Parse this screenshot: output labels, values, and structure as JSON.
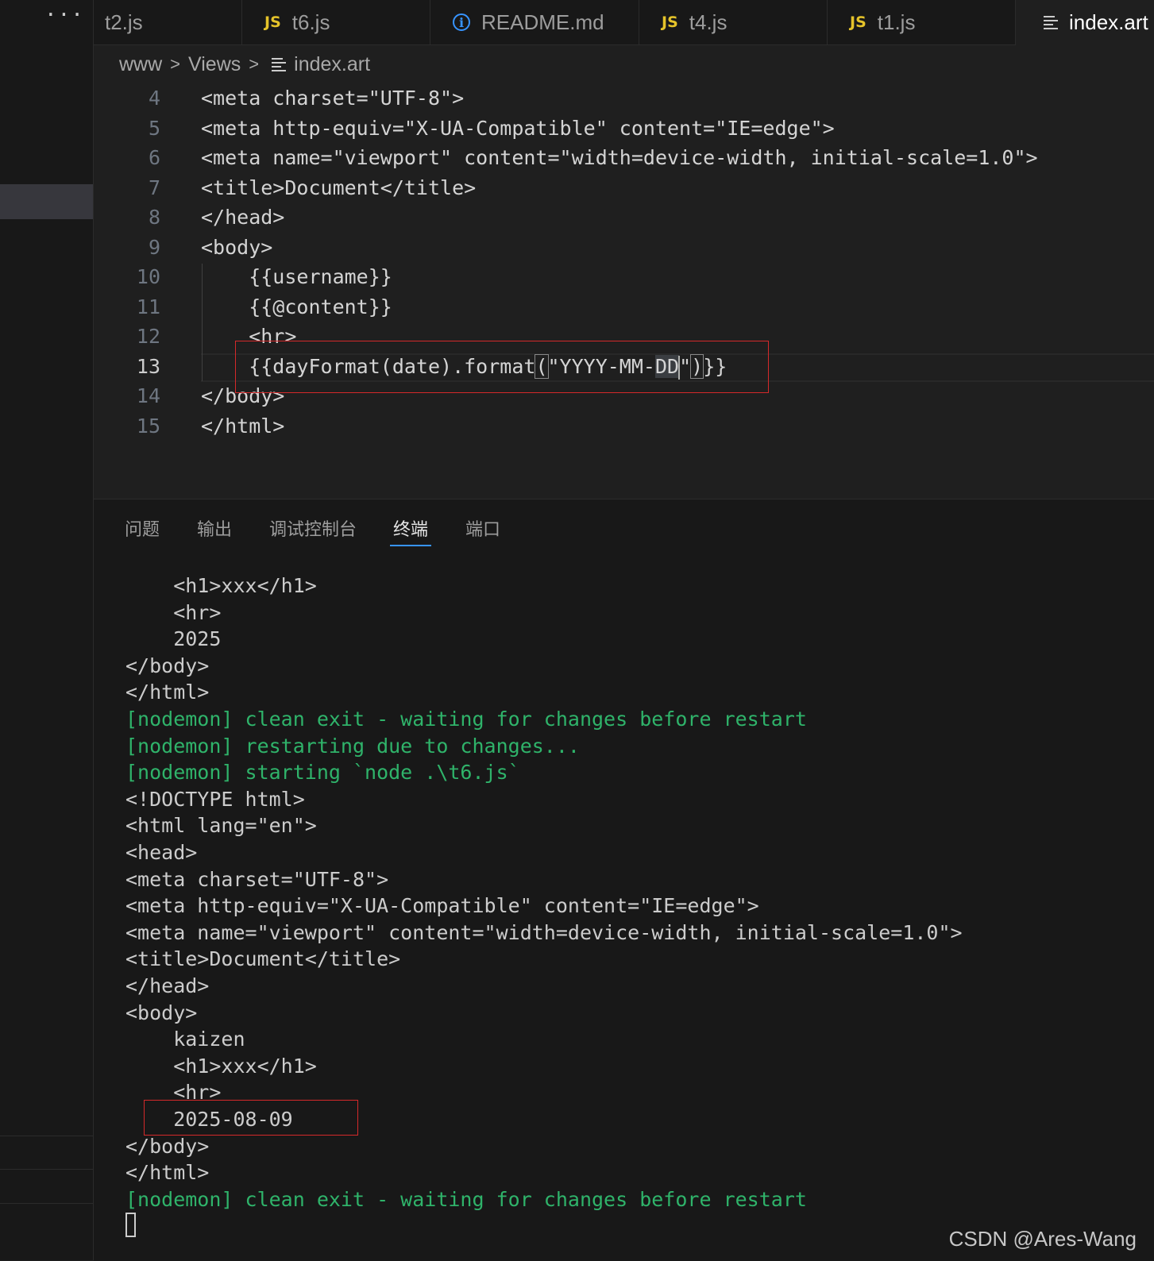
{
  "sidebar": {
    "more_label": "···"
  },
  "tabs": [
    {
      "label": "t2.js",
      "icon": "none"
    },
    {
      "label": "t6.js",
      "icon": "js-icon",
      "icon_text": "JS"
    },
    {
      "label": "README.md",
      "icon": "info-icon",
      "icon_text": "i"
    },
    {
      "label": "t4.js",
      "icon": "js-icon",
      "icon_text": "JS"
    },
    {
      "label": "t1.js",
      "icon": "js-icon",
      "icon_text": "JS"
    },
    {
      "label": "index.art",
      "icon": "file-lines-icon",
      "active": true
    }
  ],
  "breadcrumb": {
    "items": [
      "www",
      "Views",
      "index.art"
    ],
    "separator": ">"
  },
  "editor": {
    "current_line": 13,
    "lines": [
      {
        "n": "4",
        "text": "<meta charset=\"UTF-8\">"
      },
      {
        "n": "5",
        "text": "<meta http-equiv=\"X-UA-Compatible\" content=\"IE=edge\">"
      },
      {
        "n": "6",
        "text": "<meta name=\"viewport\" content=\"width=device-width, initial-scale=1.0\">"
      },
      {
        "n": "7",
        "text": "<title>Document</title>"
      },
      {
        "n": "8",
        "text": "</head>"
      },
      {
        "n": "9",
        "text": "<body>"
      },
      {
        "n": "10",
        "text": "    {{username}}"
      },
      {
        "n": "11",
        "text": "    {{@content}}"
      },
      {
        "n": "12",
        "text": "    <hr>"
      },
      {
        "n": "13",
        "text": "    {{dayFormat(date).format(\"YYYY-MM-DD\")}}"
      },
      {
        "n": "14",
        "text": "</body>"
      },
      {
        "n": "15",
        "text": "</html>"
      }
    ],
    "line13_parts": {
      "a": "    {{dayFormat(date).format",
      "open_paren": "(",
      "b": "\"YYYY-MM-",
      "sel": "DD",
      "c": "\"",
      "close_paren": ")",
      "d": "}}"
    }
  },
  "panel": {
    "tabs": [
      "问题",
      "输出",
      "调试控制台",
      "终端",
      "端口"
    ],
    "active_tab": "终端",
    "terminal_lines": [
      {
        "text": "    <h1>xxx</h1>",
        "kind": "normal"
      },
      {
        "text": "    <hr>",
        "kind": "normal"
      },
      {
        "text": "    2025",
        "kind": "normal"
      },
      {
        "text": "</body>",
        "kind": "normal"
      },
      {
        "text": "</html>",
        "kind": "normal"
      },
      {
        "text": "[nodemon] clean exit - waiting for changes before restart",
        "kind": "nodemon"
      },
      {
        "text": "[nodemon] restarting due to changes...",
        "kind": "nodemon"
      },
      {
        "text": "[nodemon] starting `node .\\t6.js`",
        "kind": "nodemon"
      },
      {
        "text": "<!DOCTYPE html>",
        "kind": "normal"
      },
      {
        "text": "<html lang=\"en\">",
        "kind": "normal"
      },
      {
        "text": "<head>",
        "kind": "normal"
      },
      {
        "text": "<meta charset=\"UTF-8\">",
        "kind": "normal"
      },
      {
        "text": "<meta http-equiv=\"X-UA-Compatible\" content=\"IE=edge\">",
        "kind": "normal"
      },
      {
        "text": "<meta name=\"viewport\" content=\"width=device-width, initial-scale=1.0\">",
        "kind": "normal"
      },
      {
        "text": "<title>Document</title>",
        "kind": "normal"
      },
      {
        "text": "</head>",
        "kind": "normal"
      },
      {
        "text": "<body>",
        "kind": "normal"
      },
      {
        "text": "    kaizen",
        "kind": "normal"
      },
      {
        "text": "    <h1>xxx</h1>",
        "kind": "normal"
      },
      {
        "text": "    <hr>",
        "kind": "normal"
      },
      {
        "text": "    2025-08-09",
        "kind": "normal"
      },
      {
        "text": "</body>",
        "kind": "normal"
      },
      {
        "text": "</html>",
        "kind": "normal"
      },
      {
        "text": "[nodemon] clean exit - waiting for changes before restart",
        "kind": "nodemon"
      }
    ]
  },
  "watermark": "CSDN @Ares-Wang",
  "colors": {
    "nodemon_green": "#2fb36a",
    "highlight_red": "#d4292a",
    "accent_blue": "#3794ff",
    "js_yellow": "#e5c32a"
  }
}
